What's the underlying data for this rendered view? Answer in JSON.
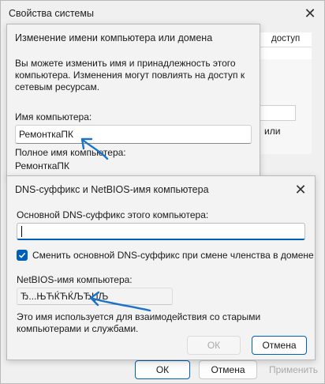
{
  "system_properties": {
    "title": "Свойства системы",
    "header_fragment": "доступ",
    "right_fragment": "или",
    "ok_label": "ОК",
    "cancel_label": "Отмена",
    "apply_label": "Применить"
  },
  "rename_dialog": {
    "title": "Изменение имени компьютера или домена",
    "description": "Вы можете изменить имя и принадлежность этого компьютера. Изменения могут повлиять на доступ к сетевым ресурсам.",
    "computer_name_label": "Имя компьютера:",
    "computer_name_value": "РемонткаПК",
    "full_name_label": "Полное имя компьютера:",
    "full_name_value": "РемонткаПК"
  },
  "dns_dialog": {
    "title": "DNS-суффикс и NetBIOS-имя компьютера",
    "dns_suffix_label": "Основной DNS-суффикс этого компьютера:",
    "dns_suffix_value": "",
    "change_suffix_checkbox_label": "Сменить основной DNS-суффикс при смене членства в домене",
    "change_suffix_checked": true,
    "netbios_label": "NetBIOS-имя компьютера:",
    "netbios_value": "Ђ...ЊЋЌЋЌЉЂЏЉ",
    "note": "Это имя используется для взаимодействия со старыми компьютерами и службами.",
    "ok_label": "ОК",
    "cancel_label": "Отмена"
  },
  "colors": {
    "accent": "#005fb8",
    "arrow": "#1a73c8"
  }
}
